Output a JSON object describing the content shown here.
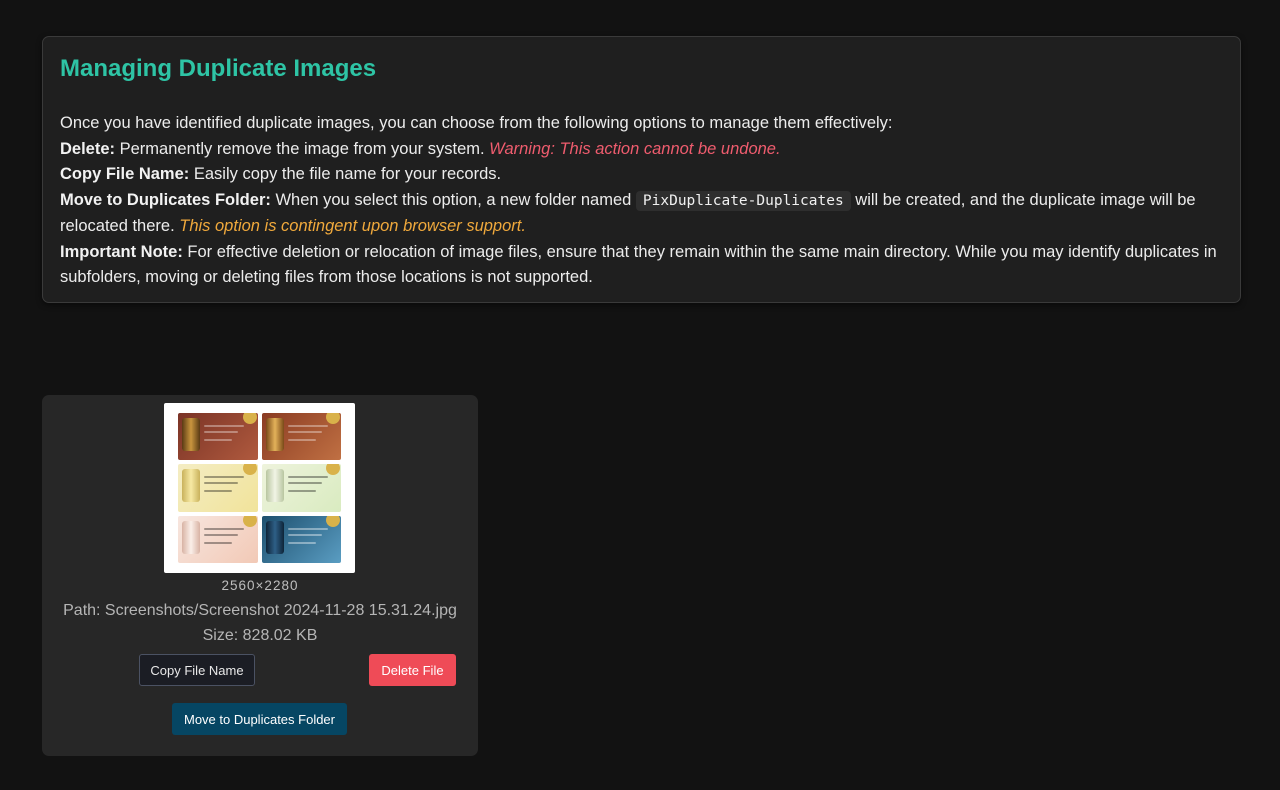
{
  "info": {
    "title": "Managing Duplicate Images",
    "intro": "Once you have identified duplicate images, you can choose from the following options to manage them effectively:",
    "delete_label": "Delete:",
    "delete_text": " Permanently remove the image from your system. ",
    "delete_warning": "Warning: This action cannot be undone.",
    "copy_label": "Copy File Name:",
    "copy_text": " Easily copy the file name for your records.",
    "move_label": "Move to Duplicates Folder:",
    "move_text_1": " When you select this option, a new folder named ",
    "move_folder": "PixDuplicate-Duplicates",
    "move_text_2": " will be created, and the duplicate image will be relocated there. ",
    "move_caution": "This option is contingent upon browser support.",
    "note_label": "Important Note:",
    "note_text": " For effective deletion or relocation of image files, ensure that they remain within the same main directory. While you may identify duplicates in subfolders, moving or deleting files from those locations is not supported."
  },
  "duplicate": {
    "dimensions": "2560×2280",
    "path": "Path: Screenshots/Screenshot 2024-11-28 15.31.24.jpg",
    "size": "Size: 828.02 KB",
    "copy_button": "Copy File Name",
    "delete_button": "Delete File",
    "move_button": "Move to Duplicates Folder"
  },
  "colors": {
    "accent_title": "#2ec4a5",
    "warning": "#ef5c6e",
    "caution": "#f0a93c",
    "delete_button": "#ef4b57",
    "move_button": "#064663"
  }
}
